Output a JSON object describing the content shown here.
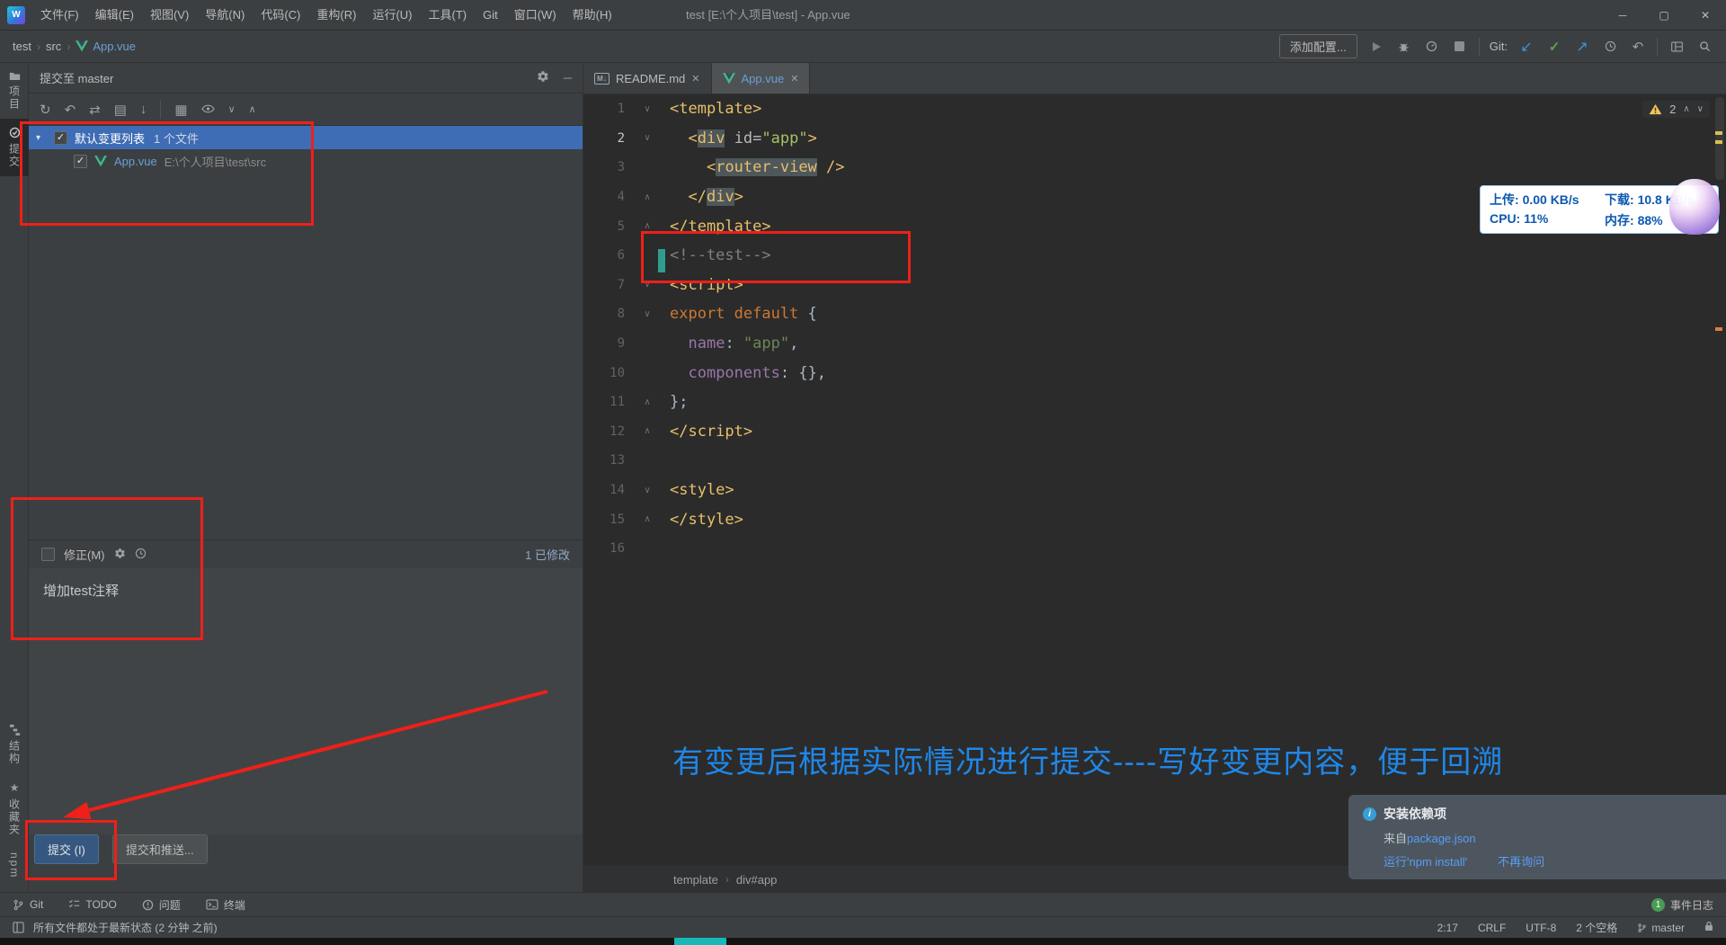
{
  "colors": {
    "selection_blue": "#3e6db5",
    "annotation_red": "#ee2019",
    "note_blue": "#1f87e8",
    "monitor_text_blue": "#0d59b0",
    "link_blue": "#589df6",
    "warning_yellow": "#f2c55c",
    "vue_green": "#41b883"
  },
  "titlebar": {
    "logo": "W",
    "menus": [
      "文件(F)",
      "编辑(E)",
      "视图(V)",
      "导航(N)",
      "代码(C)",
      "重构(R)",
      "运行(U)",
      "工具(T)",
      "Git",
      "窗口(W)",
      "帮助(H)"
    ],
    "title": "test [E:\\个人项目\\test] - App.vue",
    "window_controls": {
      "minimize": "─",
      "maximize": "▢",
      "close": "✕"
    }
  },
  "navbar": {
    "breadcrumbs": [
      "test",
      "src",
      "App.vue"
    ],
    "add_config_label": "添加配置...",
    "git_label": "Git:"
  },
  "stripe": {
    "top": [
      {
        "label": "项目"
      },
      {
        "label": "提交"
      }
    ],
    "bottom": [
      {
        "label": "结构"
      },
      {
        "label": "收藏夹"
      },
      {
        "label": "npm"
      }
    ]
  },
  "commit_panel": {
    "header": "提交至 master",
    "changelist_label": "默认变更列表",
    "changelist_count": "1 个文件",
    "file_name": "App.vue",
    "file_path": "E:\\个人项目\\test\\src",
    "amend_label": "修正(M)",
    "modified_label": "1 已修改",
    "message_text": "增加test注释",
    "commit_label": "提交 (I)",
    "commit_push_label": "提交和推送..."
  },
  "editor": {
    "tabs": [
      {
        "label": "README.md"
      },
      {
        "label": "App.vue"
      }
    ],
    "warning_count": "2",
    "breadcrumbs": [
      "template",
      "div#app"
    ],
    "lines": [
      {
        "n": "1",
        "fold": "v",
        "tokens": [
          {
            "c": "tag",
            "t": "<template>"
          }
        ]
      },
      {
        "n": "2",
        "fold": "v",
        "cur": true,
        "tokens": [
          {
            "c": "pl",
            "t": "  "
          },
          {
            "c": "tag",
            "t": "<"
          },
          {
            "c": "tag",
            "t": "div",
            "hl": true
          },
          {
            "c": "attr",
            "t": " id="
          },
          {
            "c": "val",
            "t": "\"app\""
          },
          {
            "c": "tag",
            "t": ">"
          }
        ]
      },
      {
        "n": "3",
        "tokens": [
          {
            "c": "pl",
            "t": "    "
          },
          {
            "c": "tag",
            "t": "<"
          },
          {
            "c": "tag",
            "t": "router-view",
            "hl": true
          },
          {
            "c": "tag",
            "t": " />"
          }
        ]
      },
      {
        "n": "4",
        "fold": "e",
        "tokens": [
          {
            "c": "pl",
            "t": "  "
          },
          {
            "c": "tag",
            "t": "</"
          },
          {
            "c": "tag",
            "t": "div",
            "hl": true
          },
          {
            "c": "tag",
            "t": ">"
          }
        ]
      },
      {
        "n": "5",
        "fold": "e",
        "tokens": [
          {
            "c": "tag",
            "t": "</template>"
          }
        ]
      },
      {
        "n": "6",
        "caret": true,
        "tokens": [
          {
            "c": "com",
            "t": "<!--test-->"
          }
        ]
      },
      {
        "n": "7",
        "fold": "v",
        "tokens": [
          {
            "c": "tag",
            "t": "<script>"
          }
        ]
      },
      {
        "n": "8",
        "fold": "v",
        "tokens": [
          {
            "c": "kw",
            "t": "export default"
          },
          {
            "c": "pl",
            "t": " {"
          }
        ]
      },
      {
        "n": "9",
        "tokens": [
          {
            "c": "pl",
            "t": "  "
          },
          {
            "c": "prop",
            "t": "name"
          },
          {
            "c": "pl",
            "t": ": "
          },
          {
            "c": "str",
            "t": "\"app\""
          },
          {
            "c": "pl",
            "t": ","
          }
        ]
      },
      {
        "n": "10",
        "tokens": [
          {
            "c": "pl",
            "t": "  "
          },
          {
            "c": "prop",
            "t": "components"
          },
          {
            "c": "pl",
            "t": ": "
          },
          {
            "c": "pl",
            "t": "{},"
          }
        ]
      },
      {
        "n": "11",
        "fold": "e",
        "tokens": [
          {
            "c": "pl",
            "t": "};"
          }
        ]
      },
      {
        "n": "12",
        "fold": "e",
        "tokens": [
          {
            "c": "tag",
            "t": "</script>"
          }
        ]
      },
      {
        "n": "13",
        "tokens": []
      },
      {
        "n": "14",
        "fold": "v",
        "tokens": [
          {
            "c": "tag",
            "t": "<style>"
          }
        ]
      },
      {
        "n": "15",
        "fold": "e",
        "tokens": [
          {
            "c": "tag",
            "t": "</style>"
          }
        ]
      },
      {
        "n": "16",
        "tokens": []
      }
    ]
  },
  "monitor": {
    "upload_label": "上传:",
    "upload_value": "0.00 KB/s",
    "download_label": "下载:",
    "download_value": "10.8 KB/s",
    "cpu_label": "CPU:",
    "cpu_value": "11%",
    "memory_label": "内存:",
    "memory_value": "88%"
  },
  "notification": {
    "title": "安装依赖项",
    "source_prefix": "来自",
    "source_link": "package.json",
    "action_run": "运行'npm install'",
    "action_dismiss": "不再询问"
  },
  "annotations": {
    "note": "有变更后根据实际情况进行提交----写好变更内容，便于回溯"
  },
  "bottom_bar": {
    "git": "Git",
    "todo": "TODO",
    "problems": "问题",
    "terminal": "终端",
    "event_log": "事件日志",
    "event_count": "1"
  },
  "statusbar": {
    "message": "所有文件都处于最新状态 (2 分钟 之前)",
    "caret": "2:17",
    "line_ending": "CRLF",
    "encoding": "UTF-8",
    "indent": "2 个空格",
    "branch": "master"
  }
}
